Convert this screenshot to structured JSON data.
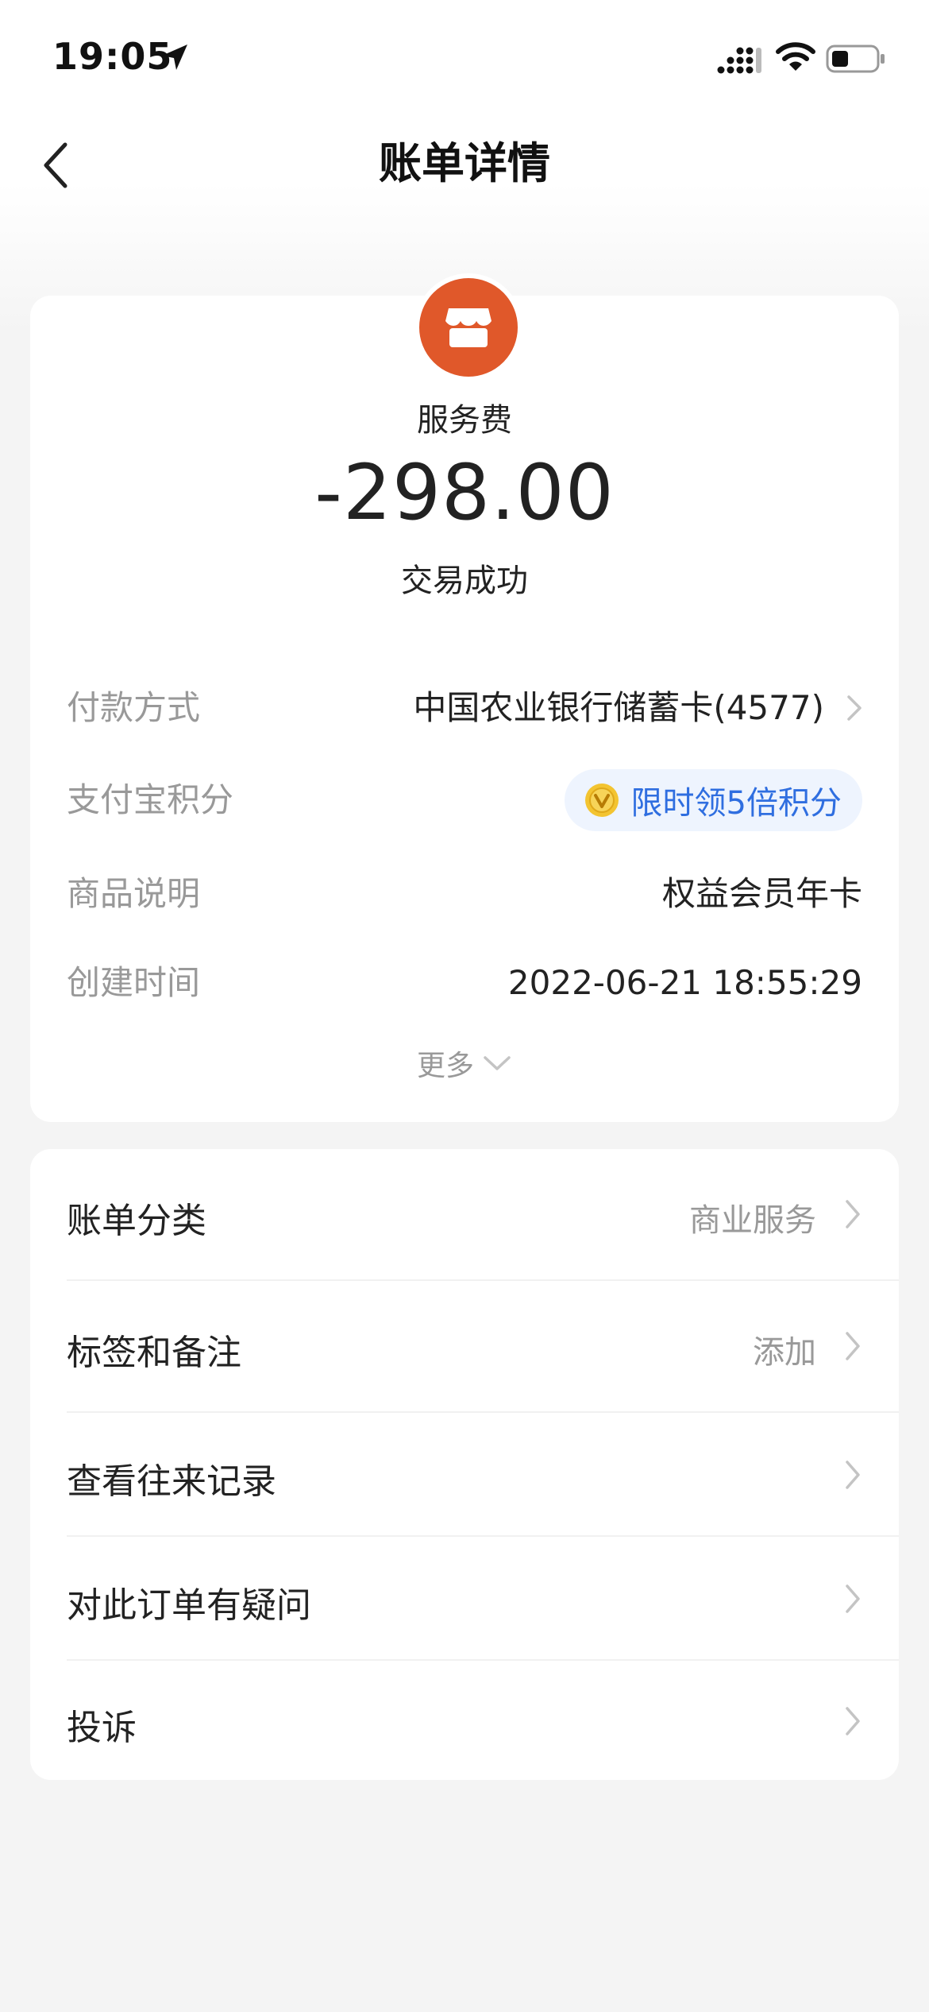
{
  "status_bar": {
    "time": "19:05",
    "icons": [
      "location-arrow-icon",
      "cellular-signal-icon",
      "wifi-icon",
      "battery-icon"
    ]
  },
  "nav": {
    "title": "账单详情",
    "back_icon": "chevron-left-icon"
  },
  "transaction": {
    "merchant_icon": "storefront-icon",
    "merchant_name": "服务费",
    "amount": "-298.00",
    "status": "交易成功"
  },
  "details": {
    "payment_method": {
      "label": "付款方式",
      "value": "中国农业银行储蓄卡(4577)"
    },
    "points": {
      "label": "支付宝积分",
      "value": "限时领5倍积分",
      "icon": "coin-icon"
    },
    "product": {
      "label": "商品说明",
      "value": "权益会员年卡"
    },
    "created": {
      "label": "创建时间",
      "value": "2022-06-21 18:55:29"
    },
    "more": "更多"
  },
  "actions": [
    {
      "label": "账单分类",
      "value": "商业服务"
    },
    {
      "label": "标签和备注",
      "value": "添加"
    },
    {
      "label": "查看往来记录",
      "value": ""
    },
    {
      "label": "对此订单有疑问",
      "value": ""
    },
    {
      "label": "投诉",
      "value": ""
    }
  ],
  "colors": {
    "accent_orange": "#e0582a",
    "link_blue": "#2f6ee0",
    "pill_bg": "#eef4fe",
    "muted_text": "#999999",
    "page_bg": "#f4f4f4"
  }
}
